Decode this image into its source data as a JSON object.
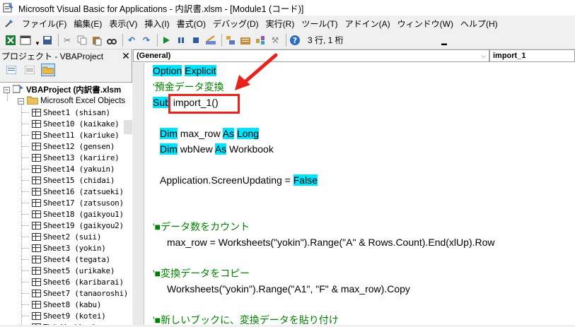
{
  "window": {
    "title": "Microsoft Visual Basic for Applications - 内訳書.xlsm - [Module1 (コード)]"
  },
  "menu": [
    "ファイル(F)",
    "編集(E)",
    "表示(V)",
    "挿入(I)",
    "書式(O)",
    "デバッグ(D)",
    "実行(R)",
    "ツール(T)",
    "アドイン(A)",
    "ウィンドウ(W)",
    "ヘルプ(H)"
  ],
  "toolbar": {
    "position": "3 行, 1 桁"
  },
  "project": {
    "title": "プロジェクト - VBAProject",
    "root": "VBAProject (内訳書.xlsm",
    "folder": "Microsoft Excel Objects",
    "sheets": [
      "Sheet1 (shisan)",
      "Sheet10 (kaikake)",
      "Sheet11 (kariuke)",
      "Sheet12 (gensen)",
      "Sheet13 (kariire)",
      "Sheet14 (yakuin)",
      "Sheet15 (chidai)",
      "Sheet16 (zatsueki)",
      "Sheet17 (zatsuson)",
      "Sheet18 (gaikyou1)",
      "Sheet19 (gaikyou2)",
      "Sheet2 (suii)",
      "Sheet3 (yokin)",
      "Sheet4 (tegata)",
      "Sheet5 (urikake)",
      "Sheet6 (karibarai)",
      "Sheet7 (tanaoroshi)",
      "Sheet8 (kabu)",
      "Sheet9 (kotei)",
      "ThisWorkbook"
    ]
  },
  "code": {
    "object_combo": "(General)",
    "proc_combo": "import_1",
    "lines": {
      "l1a": "Option",
      "l1b": "Explicit",
      "l2": "'預金データ変換",
      "l3a": "Sub",
      "l3b": "import_1()",
      "l4a": "Dim",
      "l4b": " max_row ",
      "l4c": "As",
      "l4d": "Long",
      "l5a": "Dim",
      "l5b": " wbNew ",
      "l5c": "As",
      "l5d": " Workbook",
      "l6a": "Application.ScreenUpdating = ",
      "l6b": "False",
      "l7": "'■データ数をカウント",
      "l8": "max_row = Worksheets(\"yokin\").Range(\"A\" & Rows.Count).End(xlUp).Row",
      "l9": "'■変換データをコピー",
      "l10": "Worksheets(\"yokin\").Range(\"A1\", \"F\" & max_row).Copy",
      "l11": "'■新しいブックに、変換データを貼り付け"
    }
  },
  "colors": {
    "keyword_highlight": "#00e5ff",
    "comment": "#008000",
    "annotation": "#e8231e"
  }
}
